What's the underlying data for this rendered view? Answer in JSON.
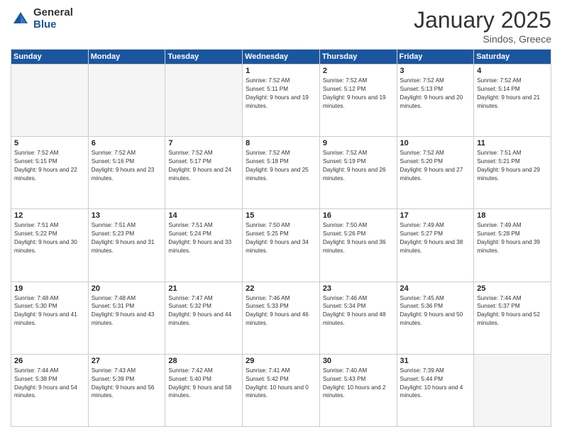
{
  "logo": {
    "general": "General",
    "blue": "Blue"
  },
  "header": {
    "title": "January 2025",
    "subtitle": "Sindos, Greece"
  },
  "days_of_week": [
    "Sunday",
    "Monday",
    "Tuesday",
    "Wednesday",
    "Thursday",
    "Friday",
    "Saturday"
  ],
  "weeks": [
    [
      {
        "day": "",
        "empty": true
      },
      {
        "day": "",
        "empty": true
      },
      {
        "day": "",
        "empty": true
      },
      {
        "day": "1",
        "sunrise": "7:52 AM",
        "sunset": "5:11 PM",
        "daylight": "9 hours and 19 minutes."
      },
      {
        "day": "2",
        "sunrise": "7:52 AM",
        "sunset": "5:12 PM",
        "daylight": "9 hours and 19 minutes."
      },
      {
        "day": "3",
        "sunrise": "7:52 AM",
        "sunset": "5:13 PM",
        "daylight": "9 hours and 20 minutes."
      },
      {
        "day": "4",
        "sunrise": "7:52 AM",
        "sunset": "5:14 PM",
        "daylight": "9 hours and 21 minutes."
      }
    ],
    [
      {
        "day": "5",
        "sunrise": "7:52 AM",
        "sunset": "5:15 PM",
        "daylight": "9 hours and 22 minutes."
      },
      {
        "day": "6",
        "sunrise": "7:52 AM",
        "sunset": "5:16 PM",
        "daylight": "9 hours and 23 minutes."
      },
      {
        "day": "7",
        "sunrise": "7:52 AM",
        "sunset": "5:17 PM",
        "daylight": "9 hours and 24 minutes."
      },
      {
        "day": "8",
        "sunrise": "7:52 AM",
        "sunset": "5:18 PM",
        "daylight": "9 hours and 25 minutes."
      },
      {
        "day": "9",
        "sunrise": "7:52 AM",
        "sunset": "5:19 PM",
        "daylight": "9 hours and 26 minutes."
      },
      {
        "day": "10",
        "sunrise": "7:52 AM",
        "sunset": "5:20 PM",
        "daylight": "9 hours and 27 minutes."
      },
      {
        "day": "11",
        "sunrise": "7:51 AM",
        "sunset": "5:21 PM",
        "daylight": "9 hours and 29 minutes."
      }
    ],
    [
      {
        "day": "12",
        "sunrise": "7:51 AM",
        "sunset": "5:22 PM",
        "daylight": "9 hours and 30 minutes."
      },
      {
        "day": "13",
        "sunrise": "7:51 AM",
        "sunset": "5:23 PM",
        "daylight": "9 hours and 31 minutes."
      },
      {
        "day": "14",
        "sunrise": "7:51 AM",
        "sunset": "5:24 PM",
        "daylight": "9 hours and 33 minutes."
      },
      {
        "day": "15",
        "sunrise": "7:50 AM",
        "sunset": "5:25 PM",
        "daylight": "9 hours and 34 minutes."
      },
      {
        "day": "16",
        "sunrise": "7:50 AM",
        "sunset": "5:26 PM",
        "daylight": "9 hours and 36 minutes."
      },
      {
        "day": "17",
        "sunrise": "7:49 AM",
        "sunset": "5:27 PM",
        "daylight": "9 hours and 38 minutes."
      },
      {
        "day": "18",
        "sunrise": "7:49 AM",
        "sunset": "5:28 PM",
        "daylight": "9 hours and 39 minutes."
      }
    ],
    [
      {
        "day": "19",
        "sunrise": "7:48 AM",
        "sunset": "5:30 PM",
        "daylight": "9 hours and 41 minutes."
      },
      {
        "day": "20",
        "sunrise": "7:48 AM",
        "sunset": "5:31 PM",
        "daylight": "9 hours and 43 minutes."
      },
      {
        "day": "21",
        "sunrise": "7:47 AM",
        "sunset": "5:32 PM",
        "daylight": "9 hours and 44 minutes."
      },
      {
        "day": "22",
        "sunrise": "7:46 AM",
        "sunset": "5:33 PM",
        "daylight": "9 hours and 46 minutes."
      },
      {
        "day": "23",
        "sunrise": "7:46 AM",
        "sunset": "5:34 PM",
        "daylight": "9 hours and 48 minutes."
      },
      {
        "day": "24",
        "sunrise": "7:45 AM",
        "sunset": "5:36 PM",
        "daylight": "9 hours and 50 minutes."
      },
      {
        "day": "25",
        "sunrise": "7:44 AM",
        "sunset": "5:37 PM",
        "daylight": "9 hours and 52 minutes."
      }
    ],
    [
      {
        "day": "26",
        "sunrise": "7:44 AM",
        "sunset": "5:38 PM",
        "daylight": "9 hours and 54 minutes."
      },
      {
        "day": "27",
        "sunrise": "7:43 AM",
        "sunset": "5:39 PM",
        "daylight": "9 hours and 56 minutes."
      },
      {
        "day": "28",
        "sunrise": "7:42 AM",
        "sunset": "5:40 PM",
        "daylight": "9 hours and 58 minutes."
      },
      {
        "day": "29",
        "sunrise": "7:41 AM",
        "sunset": "5:42 PM",
        "daylight": "10 hours and 0 minutes."
      },
      {
        "day": "30",
        "sunrise": "7:40 AM",
        "sunset": "5:43 PM",
        "daylight": "10 hours and 2 minutes."
      },
      {
        "day": "31",
        "sunrise": "7:39 AM",
        "sunset": "5:44 PM",
        "daylight": "10 hours and 4 minutes."
      },
      {
        "day": "",
        "empty": true
      }
    ]
  ],
  "labels": {
    "sunrise": "Sunrise:",
    "sunset": "Sunset:",
    "daylight": "Daylight:"
  }
}
